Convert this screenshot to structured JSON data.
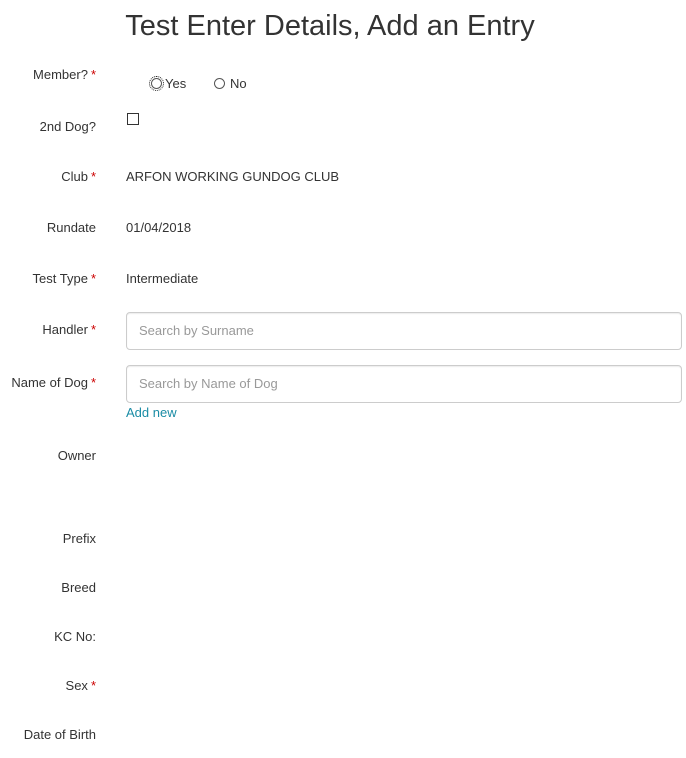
{
  "page": {
    "title": "Test Enter Details, Add an Entry"
  },
  "required_marker": "*",
  "fields": {
    "member": {
      "label": "Member?",
      "options": [
        "Yes",
        "No"
      ],
      "selected": ""
    },
    "second_dog": {
      "label": "2nd Dog?",
      "checked": false
    },
    "club": {
      "label": "Club",
      "value": "ARFON WORKING GUNDOG CLUB"
    },
    "rundate": {
      "label": "Rundate",
      "value": "01/04/2018"
    },
    "test_type": {
      "label": "Test Type",
      "value": "Intermediate"
    },
    "handler": {
      "label": "Handler",
      "placeholder": "Search by Surname",
      "value": ""
    },
    "dog_name": {
      "label": "Name of Dog",
      "placeholder": "Search by Name of Dog",
      "value": "",
      "add_new_link": "Add new"
    },
    "owner": {
      "label": "Owner"
    },
    "prefix": {
      "label": "Prefix"
    },
    "breed": {
      "label": "Breed"
    },
    "kc_no": {
      "label": "KC No:"
    },
    "sex": {
      "label": "Sex"
    },
    "dob": {
      "label": "Date of Birth"
    }
  },
  "colors": {
    "required": "#cc0000",
    "link": "#1a8ca5",
    "placeholder": "#999999",
    "text": "#333333"
  }
}
